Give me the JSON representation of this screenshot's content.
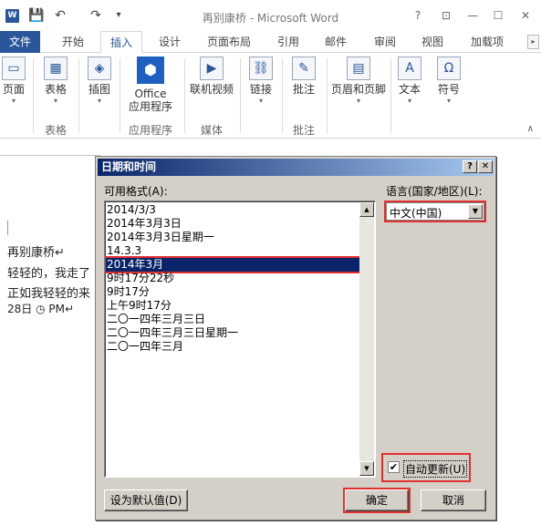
{
  "window": {
    "title": "再别康桥 - Microsoft Word",
    "logo": "W",
    "qat": {
      "save_icon": "💾",
      "undo_icon": "↶",
      "redo_icon": "↷",
      "customize_icon": "▾"
    },
    "controls": {
      "help": "?",
      "ribbon_options": "⊡",
      "minimize": "—",
      "maximize": "☐",
      "close": "✕"
    }
  },
  "tabs": [
    {
      "label": "文件"
    },
    {
      "label": "开始"
    },
    {
      "label": "插入"
    },
    {
      "label": "设计"
    },
    {
      "label": "页面布局"
    },
    {
      "label": "引用"
    },
    {
      "label": "邮件"
    },
    {
      "label": "审阅"
    },
    {
      "label": "视图"
    },
    {
      "label": "加载项"
    }
  ],
  "tab_scroll_icon": "▸",
  "ribbon": {
    "buttons": [
      {
        "label": "页面",
        "icon": "▭"
      },
      {
        "label": "表格",
        "icon": "▦"
      },
      {
        "label": "插图",
        "icon": "◈"
      },
      {
        "label": "Office",
        "label2": "应用程序",
        "icon": "⬢"
      },
      {
        "label": "联机视频",
        "icon": "▶"
      },
      {
        "label": "链接",
        "icon": "⛓"
      },
      {
        "label": "批注",
        "icon": "✎"
      },
      {
        "label": "页眉和页脚",
        "icon": "▤"
      },
      {
        "label": "文本",
        "icon": "A"
      },
      {
        "label": "符号",
        "icon": "Ω"
      }
    ],
    "groups": [
      {
        "label": "表格"
      },
      {
        "label": "应用程序"
      },
      {
        "label": "媒体"
      },
      {
        "label": "批注"
      }
    ],
    "dropdown_arrow": "▾",
    "collapse_icon": "∧"
  },
  "document": {
    "lines": [
      {
        "text": "再别康桥↵"
      },
      {
        "text": "轻轻的，我走了"
      },
      {
        "text": "正如我轻轻的来"
      },
      {
        "text": "28日  ◷  PM↵"
      }
    ]
  },
  "dialog": {
    "title": "日期和时间",
    "help_btn": "?",
    "close_btn": "✕",
    "formats_label": "可用格式(A):",
    "language_label": "语言(国家/地区)(L):",
    "language_value": "中文(中国)",
    "formats": [
      {
        "text": "2014/3/3"
      },
      {
        "text": "2014年3月3日"
      },
      {
        "text": "2014年3月3日星期一"
      },
      {
        "text": "14.3.3"
      },
      {
        "text": "2014年3月"
      },
      {
        "text": "9时17分22秒"
      },
      {
        "text": "9时17分"
      },
      {
        "text": "上午9时17分"
      },
      {
        "text": "二〇一四年三月三日"
      },
      {
        "text": "二〇一四年三月三日星期一"
      },
      {
        "text": "二〇一四年三月"
      }
    ],
    "selected_index": 4,
    "auto_update_label": "自动更新(U)",
    "auto_update_checked": "✔",
    "set_default_label": "设为默认值(D)",
    "ok_label": "确定",
    "cancel_label": "取消",
    "scroll_up": "▲",
    "scroll_down": "▼",
    "combo_arrow": "▼"
  }
}
